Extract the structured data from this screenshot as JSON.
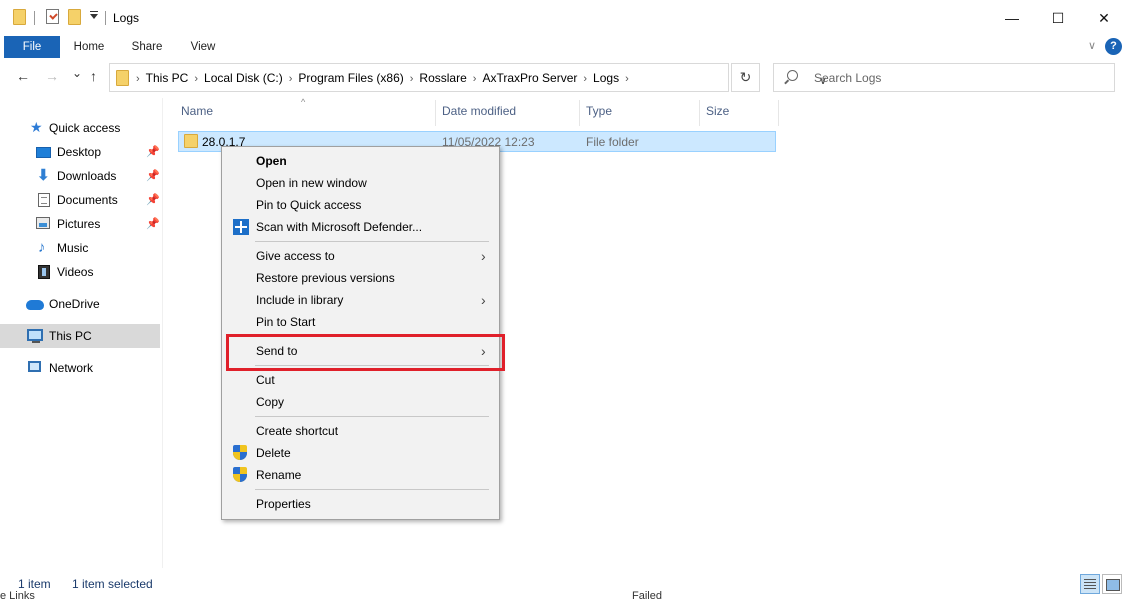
{
  "window": {
    "title": "Logs",
    "minimize": "—",
    "maximize": "☐",
    "close": "✕"
  },
  "ribbon": {
    "tabs": [
      "File",
      "Home",
      "Share",
      "View"
    ],
    "expand": "∨",
    "help": "?"
  },
  "nav": {
    "back": "←",
    "forward": "→",
    "recent": "⌄",
    "up": "↑",
    "breadcrumb": [
      "This PC",
      "Local Disk (C:)",
      "Program Files (x86)",
      "Rosslare",
      "AxTraxPro Server",
      "Logs"
    ],
    "refresh": "↻",
    "search_placeholder": "Search Logs"
  },
  "sidebar": {
    "items": [
      {
        "label": "Quick access"
      },
      {
        "label": "Desktop"
      },
      {
        "label": "Downloads"
      },
      {
        "label": "Documents"
      },
      {
        "label": "Pictures"
      },
      {
        "label": "Music"
      },
      {
        "label": "Videos"
      },
      {
        "label": "OneDrive"
      },
      {
        "label": "This PC"
      },
      {
        "label": "Network"
      }
    ],
    "selected": "This PC"
  },
  "columns": [
    "Name",
    "Date modified",
    "Type",
    "Size"
  ],
  "files": [
    {
      "name": "28.0.1.7",
      "date": "11/05/2022 12:23",
      "type": "File folder",
      "size": ""
    }
  ],
  "context_menu": {
    "items": [
      {
        "label": "Open",
        "bold": true
      },
      {
        "label": "Open in new window"
      },
      {
        "label": "Pin to Quick access"
      },
      {
        "label": "Scan with Microsoft Defender...",
        "icon": "defender-icon"
      },
      {
        "label": "Give access to",
        "submenu": true
      },
      {
        "label": "Restore previous versions"
      },
      {
        "label": "Include in library",
        "submenu": true
      },
      {
        "label": "Pin to Start"
      },
      {
        "label": "Send to",
        "submenu": true,
        "highlighted": true
      },
      {
        "label": "Cut"
      },
      {
        "label": "Copy"
      },
      {
        "label": "Create shortcut"
      },
      {
        "label": "Delete",
        "icon": "shield-icon"
      },
      {
        "label": "Rename",
        "icon": "shield-icon"
      },
      {
        "label": "Properties"
      }
    ],
    "highlight_color": "#e0202a"
  },
  "status": {
    "count": "1 item",
    "selection": "1 item selected"
  },
  "background_window": {
    "bottom_left": "e Links",
    "bottom_right": "Failed"
  },
  "colors": {
    "file_tab": "#1a64b6",
    "selection": "#cce8ff",
    "menu_bg": "#f2f2f2"
  }
}
